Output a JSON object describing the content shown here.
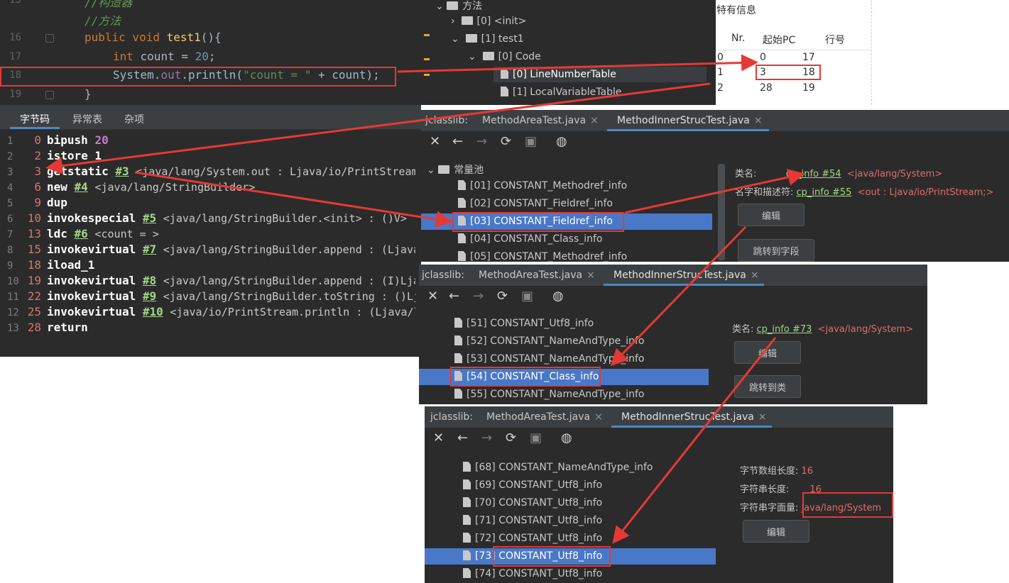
{
  "code_editor": {
    "lines": [
      {
        "num": "15",
        "text": "//构造器"
      },
      {
        "num": "",
        "text": "//方法"
      },
      {
        "num": "16",
        "text": "public void test1(){"
      },
      {
        "num": "17",
        "text_kw": "int",
        "text_rest": " count = ",
        "text_num": "20",
        "text_end": ";"
      },
      {
        "num": "18",
        "sys": "System.",
        "out": "out",
        "dot": ".",
        "fn": "println",
        "open": "(",
        "str": "\"count = \"",
        "rest": " + count);"
      },
      {
        "num": "19",
        "text": "}"
      }
    ]
  },
  "attrs_tree": {
    "items": [
      "方法",
      "[0] <init>",
      "[1] test1",
      "[0] Code",
      "[0] LineNumberTable",
      "[1] LocalVariableTable"
    ]
  },
  "info_panel": {
    "title": "特有信息",
    "headers": [
      "Nr.",
      "起始PC",
      "行号"
    ],
    "rows": [
      [
        "0",
        "0",
        "17"
      ],
      [
        "1",
        "3",
        "18"
      ],
      [
        "2",
        "28",
        "19"
      ]
    ]
  },
  "bytecode": {
    "tabs": [
      "字节码",
      "异常表",
      "杂项"
    ],
    "lines": [
      {
        "n": "1",
        "pc": "0",
        "op": "bipush",
        "num": "20"
      },
      {
        "n": "2",
        "pc": "2",
        "op": "istore_1"
      },
      {
        "n": "3",
        "pc": "3",
        "op": "getstatic",
        "ref": "#3",
        "arg": "<java/lang/System.out : Ljava/io/PrintStream>"
      },
      {
        "n": "4",
        "pc": "6",
        "op": "new",
        "ref": "#4",
        "arg": "<java/lang/StringBuilder>"
      },
      {
        "n": "5",
        "pc": "9",
        "op": "dup"
      },
      {
        "n": "6",
        "pc": "10",
        "op": "invokespecial",
        "ref": "#5",
        "arg": "<java/lang/StringBuilder.<init> : ()V>"
      },
      {
        "n": "7",
        "pc": "13",
        "op": "ldc",
        "ref": "#6",
        "arg": "<count = >"
      },
      {
        "n": "8",
        "pc": "15",
        "op": "invokevirtual",
        "ref": "#7",
        "arg": "<java/lang/StringBuilder.append : (Ljava/lang/String;)Ljava/lang/StringBuilder;>"
      },
      {
        "n": "9",
        "pc": "18",
        "op": "iload_1"
      },
      {
        "n": "10",
        "pc": "19",
        "op": "invokevirtual",
        "ref": "#8",
        "arg": "<java/lang/StringBuilder.append : (I)Ljava/lang/StringBuilder;>"
      },
      {
        "n": "11",
        "pc": "22",
        "op": "invokevirtual",
        "ref": "#9",
        "arg": "<java/lang/StringBuilder.toString : ()Ljava/lang/String;>"
      },
      {
        "n": "12",
        "pc": "25",
        "op": "invokevirtual",
        "ref": "#10",
        "arg": "<java/io/PrintStream.println : (Ljava/lang/String;)V>"
      },
      {
        "n": "13",
        "pc": "28",
        "op": "return"
      }
    ]
  },
  "jclasslib": {
    "label": "jclasslib:",
    "tab1": "MethodAreaTest.java",
    "tab2": "MethodInnerStrucTest.java",
    "win1": {
      "tree_root": "常量池",
      "items": [
        "[01] CONSTANT_Methodref_info",
        "[02] CONSTANT_Fieldref_info",
        "[03] CONSTANT_Fieldref_info",
        "[04] CONSTANT_Class_info",
        "[05] CONSTANT_Methodref_info"
      ],
      "class_label": "类名:",
      "class_link": "cp_info #54",
      "class_val": "<java/lang/System>",
      "nt_label": "名字和描述符:",
      "nt_link": "cp_info #55",
      "nt_val": "<out : Ljava/io/PrintStream;>",
      "edit_btn": "编辑",
      "jump_btn": "跳转到字段"
    },
    "win2": {
      "items": [
        "[51] CONSTANT_Utf8_info",
        "[52] CONSTANT_NameAndType_info",
        "[53] CONSTANT_NameAndType_info",
        "[54] CONSTANT_Class_info",
        "[55] CONSTANT_NameAndType_info"
      ],
      "class_label": "类名:",
      "class_link": "cp_info #73",
      "class_val": "<java/lang/System>",
      "edit_btn": "编辑",
      "jump_btn": "跳转到类"
    },
    "win3": {
      "items": [
        "[68] CONSTANT_NameAndType_info",
        "[69] CONSTANT_Utf8_info",
        "[70] CONSTANT_Utf8_info",
        "[71] CONSTANT_Utf8_info",
        "[72] CONSTANT_Utf8_info",
        "[73] CONSTANT_Utf8_info",
        "[74] CONSTANT_Utf8_info"
      ],
      "len_label": "字节数组长度:",
      "len_val": "16",
      "strlen_label": "字符串长度:",
      "strlen_val": "16",
      "str_label": "字符串字面量:",
      "str_val": "java/lang/System",
      "edit_btn": "编辑"
    }
  },
  "colors": {
    "highlight_box": "#e53935",
    "selection": "#4a78c8",
    "editor_bg": "#2b2b2b"
  }
}
